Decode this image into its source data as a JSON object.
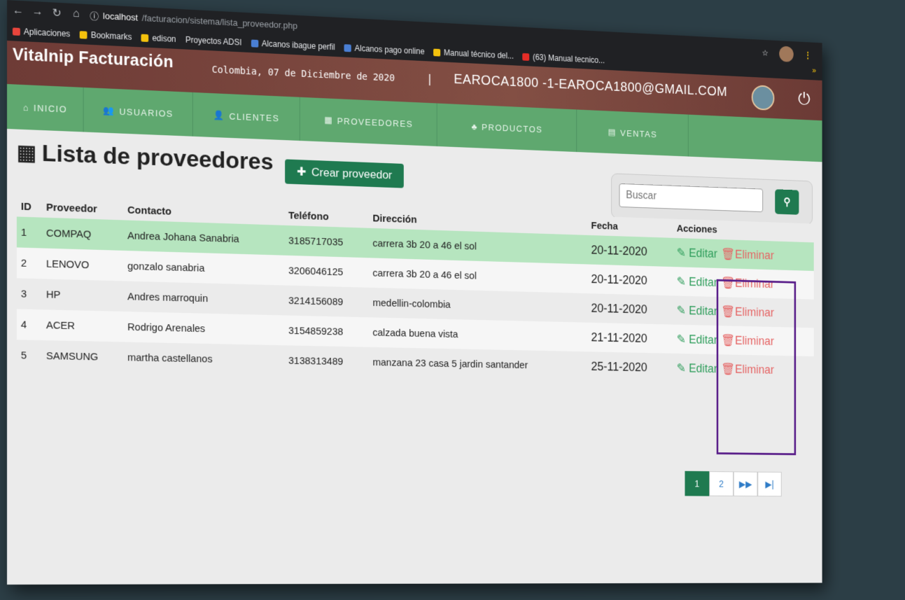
{
  "browser": {
    "url_host": "localhost",
    "url_path": "/facturacion/sistema/lista_proveedor.php",
    "bookmarks": [
      {
        "label": "Aplicaciones",
        "color": "#e8453c"
      },
      {
        "label": "Bookmarks",
        "color": "#f4c20d"
      },
      {
        "label": "edison",
        "color": "#f4c20d"
      },
      {
        "label": "Proyectos ADSI",
        "color": ""
      },
      {
        "label": "Alcanos ibague perfil",
        "color": "#4a7fd4"
      },
      {
        "label": "Alcanos pago online",
        "color": "#4a7fd4"
      },
      {
        "label": "Manual técnico del...",
        "color": "#f4c20d"
      },
      {
        "label": "(63) Manual tecnico...",
        "color": "#e52d27"
      }
    ],
    "more": "»"
  },
  "header": {
    "brand": "Vitalnip Facturación",
    "date": "Colombia, 07 de Diciembre de 2020",
    "separator": "|",
    "user": "EAROCA1800 -1-EAROCA1800@GMAIL.COM"
  },
  "nav": [
    {
      "icon": "⌂",
      "label": "INICIO",
      "width": 110
    },
    {
      "icon": "👥",
      "label": "USUARIOS",
      "width": 160
    },
    {
      "icon": "👤",
      "label": "CLIENTES",
      "width": 160
    },
    {
      "icon": "▦",
      "label": "PROVEEDORES",
      "width": 210
    },
    {
      "icon": "♣",
      "label": "PRODUCTOS",
      "width": 220
    },
    {
      "icon": "▤",
      "label": "VENTAS",
      "width": 180
    }
  ],
  "main": {
    "title": "Lista de proveedores",
    "create_label": "Crear proveedor",
    "search_placeholder": "Buscar",
    "columns": [
      "ID",
      "Proveedor",
      "Contacto",
      "Teléfono",
      "Dirección",
      "Fecha",
      "Acciones"
    ],
    "rows": [
      {
        "id": "1",
        "proveedor": "COMPAQ",
        "contacto": "Andrea Johana Sanabria",
        "telefono": "3185717035",
        "direccion": "carrera 3b 20 a 46 el sol",
        "fecha": "20-11-2020"
      },
      {
        "id": "2",
        "proveedor": "LENOVO",
        "contacto": "gonzalo sanabria",
        "telefono": "3206046125",
        "direccion": "carrera 3b 20 a 46 el sol",
        "fecha": "20-11-2020"
      },
      {
        "id": "3",
        "proveedor": "HP",
        "contacto": "Andres marroquin",
        "telefono": "3214156089",
        "direccion": "medellin-colombia",
        "fecha": "20-11-2020"
      },
      {
        "id": "4",
        "proveedor": "ACER",
        "contacto": "Rodrigo Arenales",
        "telefono": "3154859238",
        "direccion": "calzada buena vista",
        "fecha": "21-11-2020"
      },
      {
        "id": "5",
        "proveedor": "SAMSUNG",
        "contacto": "martha castellanos",
        "telefono": "3138313489",
        "direccion": "manzana 23 casa 5 jardin santander",
        "fecha": "25-11-2020"
      }
    ],
    "edit_label": "Editar",
    "delete_label": "Eliminar",
    "pages": [
      "1",
      "2"
    ],
    "page_next": "▶▶",
    "page_last": "▶|"
  },
  "colors": {
    "header_bg": "#7a4a40",
    "nav_bg": "#5fa86f",
    "accent": "#1f7a50",
    "delete": "#e56464",
    "edit": "#2e9d5b"
  }
}
